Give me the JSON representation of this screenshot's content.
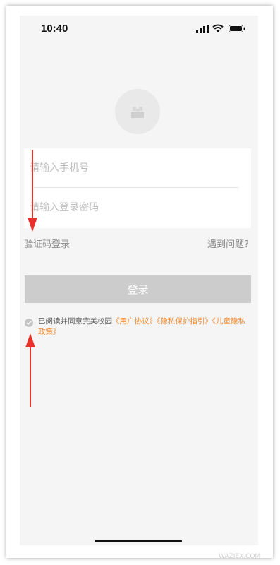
{
  "status_bar": {
    "time": "10:40",
    "icons": [
      "cellular-signal-icon",
      "wifi-icon",
      "battery-icon"
    ]
  },
  "logo": {
    "icon": "app-logo-placeholder"
  },
  "form": {
    "phone_placeholder": "请输入手机号",
    "password_placeholder": "请输入登录密码"
  },
  "links": {
    "sms_login": "验证码登录",
    "problem": "遇到问题?"
  },
  "login_button": {
    "label": "登录",
    "color": "#cccccc"
  },
  "agreement": {
    "prefix": "已阅读并同意完美校园",
    "user_agreement": "《用户协议》",
    "privacy_guide": "《隐私保护指引》",
    "children_privacy": "《儿童隐私政策》",
    "link_color": "#f0882e",
    "checked": false
  },
  "annotations": {
    "arrow_color": "#e8312b"
  },
  "watermark": "WAZJEX.COM",
  "colors": {
    "background": "#f5f5f5",
    "input_background": "#ffffff",
    "placeholder": "#bdbdbd",
    "secondary_text": "#8a8a8a"
  }
}
